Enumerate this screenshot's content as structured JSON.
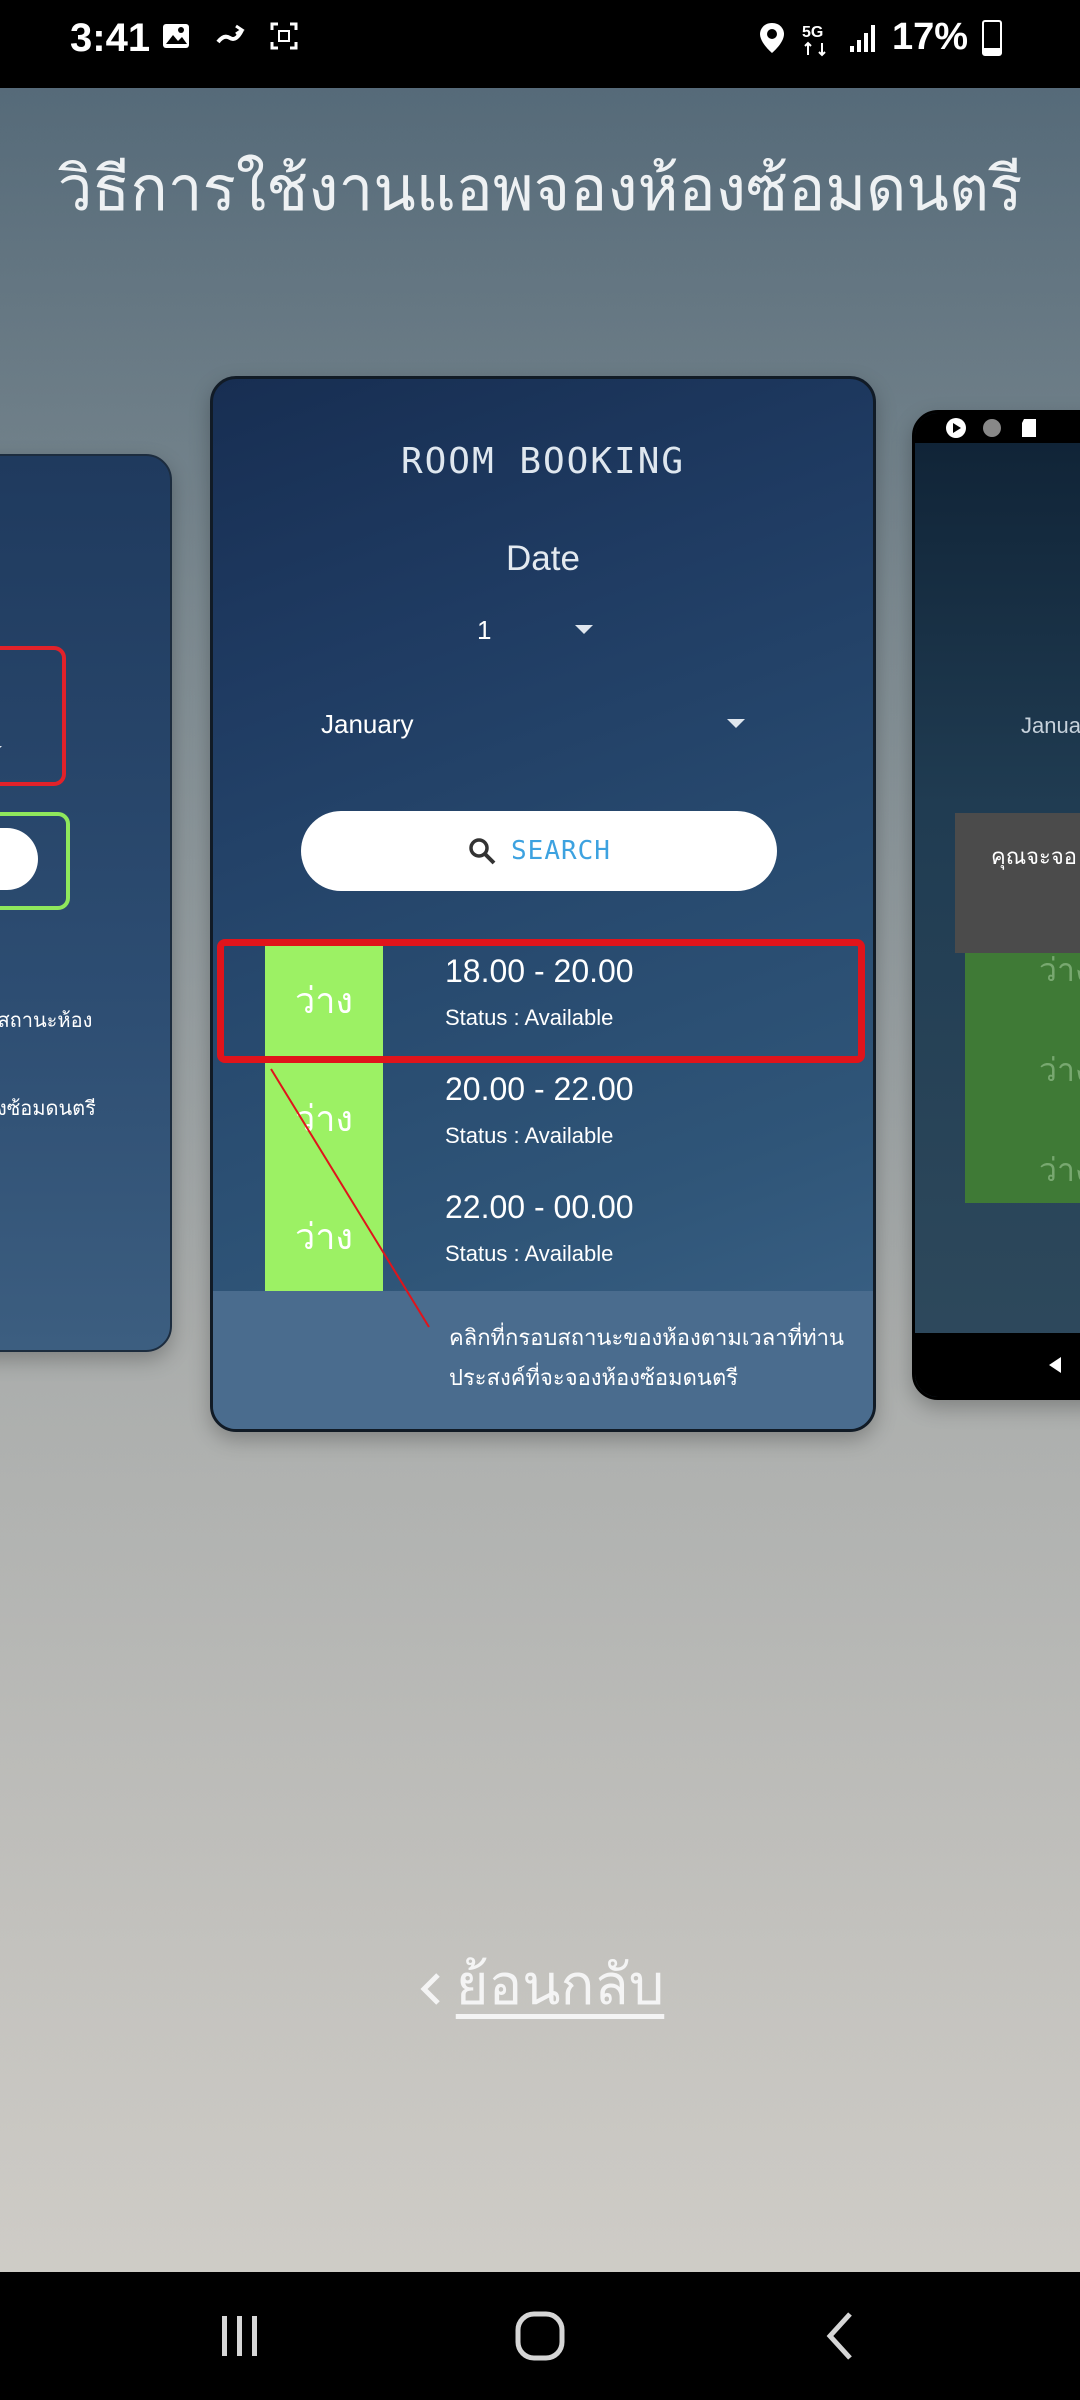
{
  "status_bar": {
    "time": "3:41",
    "battery": "17%",
    "icons": [
      "image-icon",
      "cast-icon",
      "screenshot-icon",
      "location-icon",
      "5g-icon",
      "signal-icon",
      "battery-icon"
    ]
  },
  "page_title": "วิธีการใช้งานแอพจองห้องซ้อมดนตรี",
  "main_card": {
    "title": "ROOM BOOKING",
    "date_label": "Date",
    "day_value": "1",
    "month_value": "January",
    "search_label": "SEARCH",
    "slots": [
      {
        "badge": "ว่าง",
        "time": "18.00 - 20.00",
        "status": "Status : Available"
      },
      {
        "badge": "ว่าง",
        "time": "20.00 - 22.00",
        "status": "Status : Available"
      },
      {
        "badge": "ว่าง",
        "time": "22.00 - 00.00",
        "status": "Status : Available"
      }
    ],
    "note_line1": "คลิกที่กรอบสถานะของห้องตามเวลาที่ท่าน",
    "note_line2": "ประสงค์ที่จะจองห้องซ้อมดนตรี",
    "highlight_color": "#e0141b",
    "available_color": "#9cf164"
  },
  "left_card": {
    "text1": "ของสถานะห้อง",
    "text2": "งห้องซ้อมดนตรี"
  },
  "right_card": {
    "month_partial": "Janua",
    "dialog_partial": "คุณจะจอ",
    "badges": [
      "ว่าง",
      "ว่าง",
      "ว่าง"
    ]
  },
  "back_link": "ย้อนกลับ"
}
